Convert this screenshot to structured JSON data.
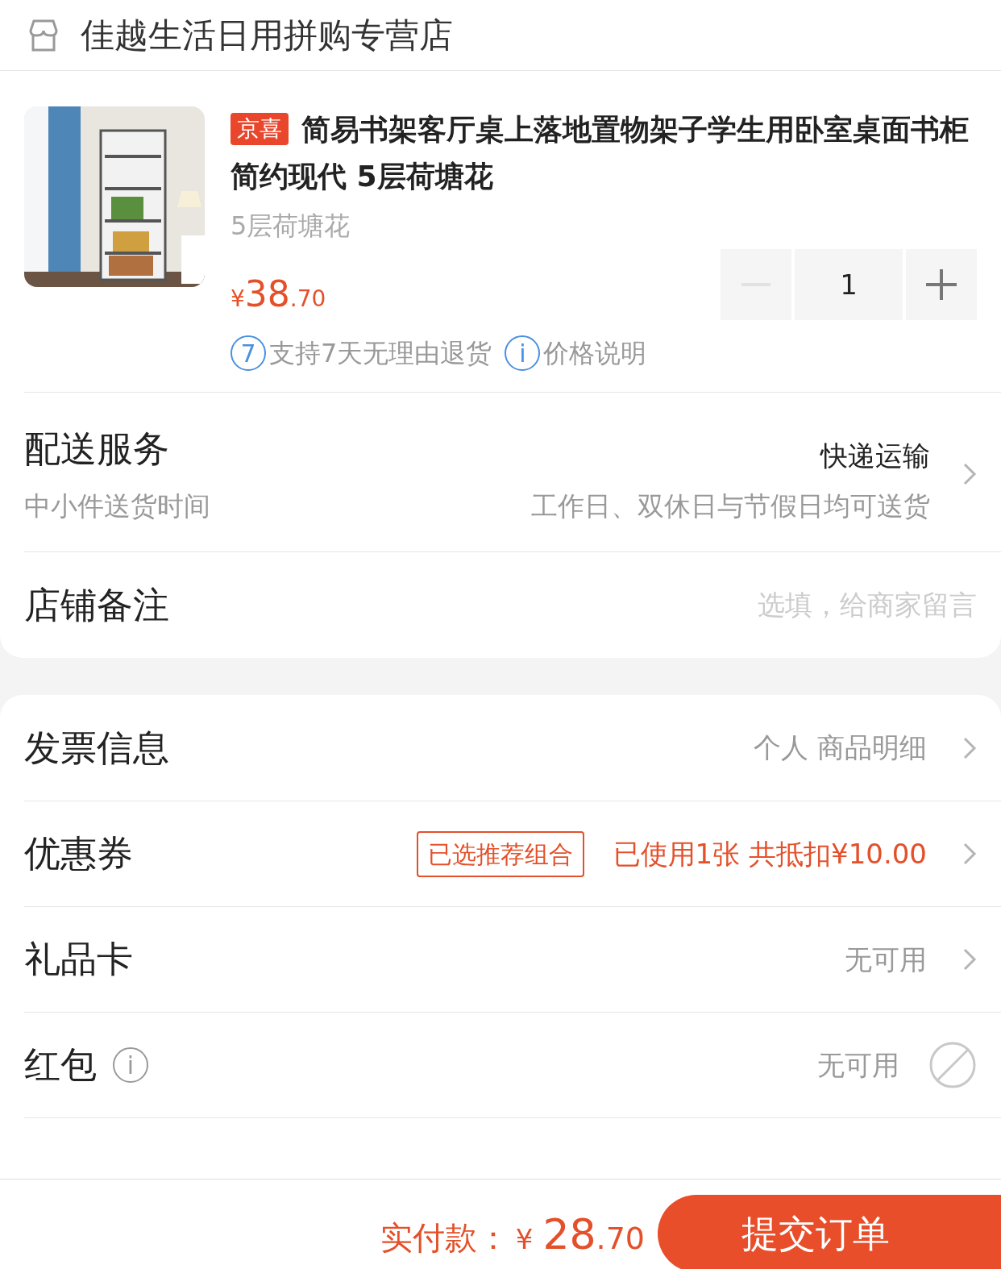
{
  "store": {
    "name": "佳越生活日用拼购专营店"
  },
  "product": {
    "tag": "京喜",
    "title": "简易书架客厅桌上落地置物架子学生用卧室桌面书柜简约现代 5层荷塘花",
    "spec": "5层荷塘花",
    "price": {
      "symbol": "¥",
      "integer": "38",
      "decimal": ".70"
    },
    "quantity": "1",
    "decrement_disabled": true,
    "badges": [
      {
        "icon_text": "7",
        "text": "支持7天无理由退货"
      },
      {
        "icon_text": "i",
        "text": "价格说明"
      }
    ]
  },
  "delivery": {
    "label": "配送服务",
    "sublabel": "中小件送货时间",
    "value": "快递运输",
    "subvalue": "工作日、双休日与节假日均可送货"
  },
  "note": {
    "label": "店铺备注",
    "placeholder": "选填，给商家留言"
  },
  "rows": [
    {
      "kind": "arrow",
      "label": "发票信息",
      "value": "个人 商品明细",
      "highlight": false
    },
    {
      "kind": "arrow",
      "label": "优惠券",
      "tag": "已选推荐组合",
      "value": "已使用1张 共抵扣¥10.00",
      "highlight": true
    },
    {
      "kind": "arrow",
      "label": "礼品卡",
      "value": "无可用",
      "highlight": false
    },
    {
      "kind": "disabled",
      "label": "红包",
      "info": "i",
      "value": "无可用",
      "highlight": false
    }
  ],
  "footer": {
    "label": "实付款：",
    "symbol": "¥",
    "integer": "28",
    "decimal": ".70",
    "submit": "提交订单"
  }
}
